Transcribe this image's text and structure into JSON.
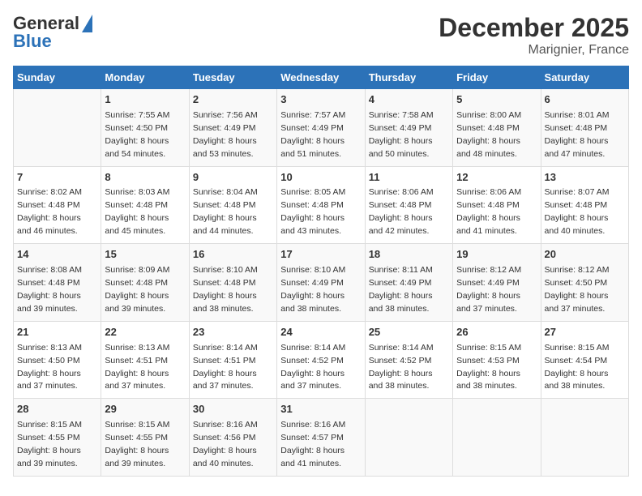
{
  "logo": {
    "line1": "General",
    "line2": "Blue"
  },
  "title": "December 2025",
  "subtitle": "Marignier, France",
  "weekdays": [
    "Sunday",
    "Monday",
    "Tuesday",
    "Wednesday",
    "Thursday",
    "Friday",
    "Saturday"
  ],
  "weeks": [
    [
      {
        "day": "",
        "info": ""
      },
      {
        "day": "1",
        "info": "Sunrise: 7:55 AM\nSunset: 4:50 PM\nDaylight: 8 hours\nand 54 minutes."
      },
      {
        "day": "2",
        "info": "Sunrise: 7:56 AM\nSunset: 4:49 PM\nDaylight: 8 hours\nand 53 minutes."
      },
      {
        "day": "3",
        "info": "Sunrise: 7:57 AM\nSunset: 4:49 PM\nDaylight: 8 hours\nand 51 minutes."
      },
      {
        "day": "4",
        "info": "Sunrise: 7:58 AM\nSunset: 4:49 PM\nDaylight: 8 hours\nand 50 minutes."
      },
      {
        "day": "5",
        "info": "Sunrise: 8:00 AM\nSunset: 4:48 PM\nDaylight: 8 hours\nand 48 minutes."
      },
      {
        "day": "6",
        "info": "Sunrise: 8:01 AM\nSunset: 4:48 PM\nDaylight: 8 hours\nand 47 minutes."
      }
    ],
    [
      {
        "day": "7",
        "info": "Sunrise: 8:02 AM\nSunset: 4:48 PM\nDaylight: 8 hours\nand 46 minutes."
      },
      {
        "day": "8",
        "info": "Sunrise: 8:03 AM\nSunset: 4:48 PM\nDaylight: 8 hours\nand 45 minutes."
      },
      {
        "day": "9",
        "info": "Sunrise: 8:04 AM\nSunset: 4:48 PM\nDaylight: 8 hours\nand 44 minutes."
      },
      {
        "day": "10",
        "info": "Sunrise: 8:05 AM\nSunset: 4:48 PM\nDaylight: 8 hours\nand 43 minutes."
      },
      {
        "day": "11",
        "info": "Sunrise: 8:06 AM\nSunset: 4:48 PM\nDaylight: 8 hours\nand 42 minutes."
      },
      {
        "day": "12",
        "info": "Sunrise: 8:06 AM\nSunset: 4:48 PM\nDaylight: 8 hours\nand 41 minutes."
      },
      {
        "day": "13",
        "info": "Sunrise: 8:07 AM\nSunset: 4:48 PM\nDaylight: 8 hours\nand 40 minutes."
      }
    ],
    [
      {
        "day": "14",
        "info": "Sunrise: 8:08 AM\nSunset: 4:48 PM\nDaylight: 8 hours\nand 39 minutes."
      },
      {
        "day": "15",
        "info": "Sunrise: 8:09 AM\nSunset: 4:48 PM\nDaylight: 8 hours\nand 39 minutes."
      },
      {
        "day": "16",
        "info": "Sunrise: 8:10 AM\nSunset: 4:48 PM\nDaylight: 8 hours\nand 38 minutes."
      },
      {
        "day": "17",
        "info": "Sunrise: 8:10 AM\nSunset: 4:49 PM\nDaylight: 8 hours\nand 38 minutes."
      },
      {
        "day": "18",
        "info": "Sunrise: 8:11 AM\nSunset: 4:49 PM\nDaylight: 8 hours\nand 38 minutes."
      },
      {
        "day": "19",
        "info": "Sunrise: 8:12 AM\nSunset: 4:49 PM\nDaylight: 8 hours\nand 37 minutes."
      },
      {
        "day": "20",
        "info": "Sunrise: 8:12 AM\nSunset: 4:50 PM\nDaylight: 8 hours\nand 37 minutes."
      }
    ],
    [
      {
        "day": "21",
        "info": "Sunrise: 8:13 AM\nSunset: 4:50 PM\nDaylight: 8 hours\nand 37 minutes."
      },
      {
        "day": "22",
        "info": "Sunrise: 8:13 AM\nSunset: 4:51 PM\nDaylight: 8 hours\nand 37 minutes."
      },
      {
        "day": "23",
        "info": "Sunrise: 8:14 AM\nSunset: 4:51 PM\nDaylight: 8 hours\nand 37 minutes."
      },
      {
        "day": "24",
        "info": "Sunrise: 8:14 AM\nSunset: 4:52 PM\nDaylight: 8 hours\nand 37 minutes."
      },
      {
        "day": "25",
        "info": "Sunrise: 8:14 AM\nSunset: 4:52 PM\nDaylight: 8 hours\nand 38 minutes."
      },
      {
        "day": "26",
        "info": "Sunrise: 8:15 AM\nSunset: 4:53 PM\nDaylight: 8 hours\nand 38 minutes."
      },
      {
        "day": "27",
        "info": "Sunrise: 8:15 AM\nSunset: 4:54 PM\nDaylight: 8 hours\nand 38 minutes."
      }
    ],
    [
      {
        "day": "28",
        "info": "Sunrise: 8:15 AM\nSunset: 4:55 PM\nDaylight: 8 hours\nand 39 minutes."
      },
      {
        "day": "29",
        "info": "Sunrise: 8:15 AM\nSunset: 4:55 PM\nDaylight: 8 hours\nand 39 minutes."
      },
      {
        "day": "30",
        "info": "Sunrise: 8:16 AM\nSunset: 4:56 PM\nDaylight: 8 hours\nand 40 minutes."
      },
      {
        "day": "31",
        "info": "Sunrise: 8:16 AM\nSunset: 4:57 PM\nDaylight: 8 hours\nand 41 minutes."
      },
      {
        "day": "",
        "info": ""
      },
      {
        "day": "",
        "info": ""
      },
      {
        "day": "",
        "info": ""
      }
    ]
  ]
}
